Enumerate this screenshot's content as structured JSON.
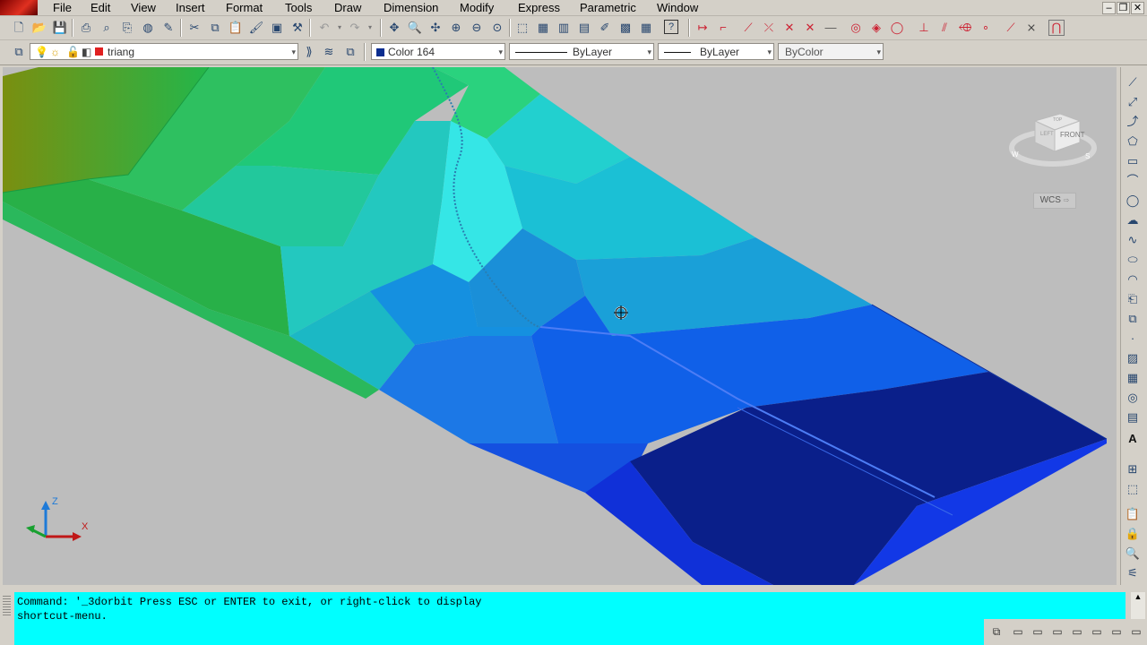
{
  "menu": {
    "items": [
      {
        "label": "File"
      },
      {
        "label": "Edit"
      },
      {
        "label": "View"
      },
      {
        "label": "Insert"
      },
      {
        "label": "Format"
      },
      {
        "label": "Tools"
      },
      {
        "label": "Draw"
      },
      {
        "label": "Dimension"
      },
      {
        "label": "Modify"
      },
      {
        "label": "Express"
      },
      {
        "label": "Parametric"
      },
      {
        "label": "Window"
      }
    ]
  },
  "layers": {
    "current_layer": "triang"
  },
  "properties": {
    "color": "Color 164",
    "color_swatch": "#0b2d8f",
    "linetype": "ByLayer",
    "lineweight": "ByLayer",
    "plot_style": "ByColor"
  },
  "viewport": {
    "background": "#bdbdbd",
    "viewcube": {
      "face_front": "FRONT",
      "face_left": "LEFT",
      "face_top": "TOP",
      "compass": [
        "W",
        "S"
      ]
    },
    "wcs_label": "WCS",
    "ucs": {
      "z": "Z",
      "x": "X"
    }
  },
  "command": {
    "line1": "Command: '_3dorbit Press ESC or ENTER to exit, or right-click to display",
    "line2": "shortcut-menu."
  },
  "icons": {
    "toolbar": [
      "new-icon",
      "open-icon",
      "save-icon",
      "plot-icon",
      "plot-preview-icon",
      "publish-icon",
      "3d-dwf-icon",
      "design-center-icon",
      "cut-icon",
      "copy-icon",
      "paste-icon",
      "match-properties-icon",
      "block-editor-icon",
      "undo-icon",
      "redo-icon",
      "pan-icon",
      "zoom-realtime-icon",
      "zoom-window-icon",
      "zoom-previous-icon",
      "properties-icon",
      "design-center-icon-2",
      "tool-palettes-icon",
      "sheet-set-icon",
      "markup-icon",
      "quickcalc-icon",
      "help-icon"
    ],
    "draw": [
      "line-icon",
      "construction-line-icon",
      "polyline-icon",
      "polygon-icon",
      "rectangle-icon",
      "arc-icon",
      "circle-icon",
      "revision-cloud-icon",
      "spline-icon",
      "ellipse-icon",
      "ellipse-arc-icon",
      "insert-block-icon",
      "make-block-icon",
      "point-icon",
      "hatch-icon",
      "gradient-icon",
      "region-icon",
      "table-icon",
      "text-icon",
      "add-selected-icon"
    ]
  }
}
